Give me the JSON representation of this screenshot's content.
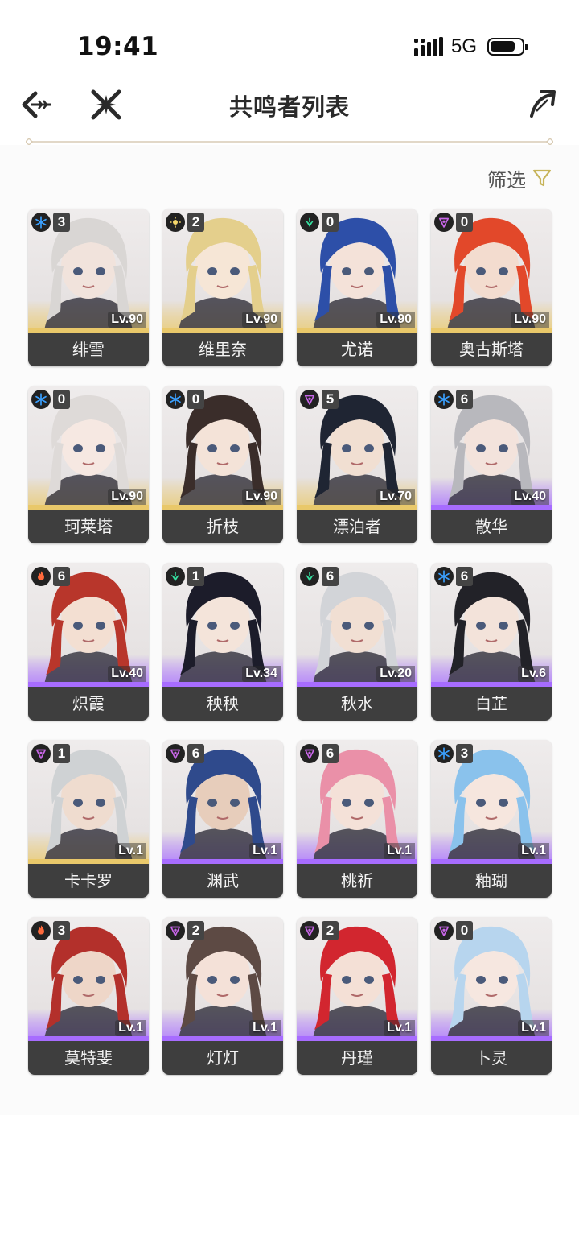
{
  "status_bar": {
    "time": "19:41",
    "network": "5G"
  },
  "header": {
    "title": "共鸣者列表",
    "back_icon": "back-arrow-icon",
    "close_icon": "cross-icon",
    "share_icon": "share-arrow-icon"
  },
  "filter": {
    "label": "筛选",
    "icon": "filter-icon",
    "accent": "#c7b45a"
  },
  "rarity_colors": {
    "5": "#e9c86a",
    "4": "#a76cff"
  },
  "element_colors": {
    "glacio": "#3aa0ff",
    "spectro": "#f5d76b",
    "aero": "#35e0a0",
    "havoc": "#c866e8",
    "fusion": "#ff6a3c"
  },
  "characters": [
    {
      "name": "绯雪",
      "level": "Lv.90",
      "cons": "3",
      "element": "glacio",
      "rarity": "5",
      "hair": "#d9d6d4",
      "skin": "#f1e3dc"
    },
    {
      "name": "维里奈",
      "level": "Lv.90",
      "cons": "2",
      "element": "spectro",
      "rarity": "5",
      "hair": "#e4cf8c",
      "skin": "#f6e6d6"
    },
    {
      "name": "尤诺",
      "level": "Lv.90",
      "cons": "0",
      "element": "aero",
      "rarity": "5",
      "hair": "#2d4fa8",
      "skin": "#f4e2d9"
    },
    {
      "name": "奥古斯塔",
      "level": "Lv.90",
      "cons": "0",
      "element": "havoc",
      "rarity": "5",
      "hair": "#e2482a",
      "skin": "#f3dccf"
    },
    {
      "name": "珂莱塔",
      "level": "Lv.90",
      "cons": "0",
      "element": "glacio",
      "rarity": "5",
      "hair": "#dedad8",
      "skin": "#f6e8e2"
    },
    {
      "name": "折枝",
      "level": "Lv.90",
      "cons": "0",
      "element": "glacio",
      "rarity": "5",
      "hair": "#3a2d2a",
      "skin": "#f4e3d8"
    },
    {
      "name": "漂泊者",
      "level": "Lv.70",
      "cons": "5",
      "element": "havoc",
      "rarity": "5",
      "hair": "#1f2533",
      "skin": "#f1dfd2"
    },
    {
      "name": "散华",
      "level": "Lv.40",
      "cons": "6",
      "element": "glacio",
      "rarity": "4",
      "hair": "#b8b8bd",
      "skin": "#f3e3dc"
    },
    {
      "name": "炽霞",
      "level": "Lv.40",
      "cons": "6",
      "element": "fusion",
      "rarity": "4",
      "hair": "#b8362b",
      "skin": "#f3dfd2"
    },
    {
      "name": "秧秧",
      "level": "Lv.34",
      "cons": "1",
      "element": "aero",
      "rarity": "4",
      "hair": "#1c1c2a",
      "skin": "#f4e4da"
    },
    {
      "name": "秋水",
      "level": "Lv.20",
      "cons": "6",
      "element": "aero",
      "rarity": "4",
      "hair": "#d2d4d8",
      "skin": "#f1dfd3"
    },
    {
      "name": "白芷",
      "level": "Lv.6",
      "cons": "6",
      "element": "glacio",
      "rarity": "4",
      "hair": "#222228",
      "skin": "#f3e3da"
    },
    {
      "name": "卡卡罗",
      "level": "Lv.1",
      "cons": "1",
      "element": "havoc",
      "rarity": "5",
      "hair": "#cfd2d4",
      "skin": "#efdccf"
    },
    {
      "name": "渊武",
      "level": "Lv.1",
      "cons": "6",
      "element": "havoc",
      "rarity": "4",
      "hair": "#2f4a8c",
      "skin": "#e7cdbb"
    },
    {
      "name": "桃祈",
      "level": "Lv.1",
      "cons": "6",
      "element": "havoc",
      "rarity": "4",
      "hair": "#ea90a8",
      "skin": "#f4e1d8"
    },
    {
      "name": "釉瑚",
      "level": "Lv.1",
      "cons": "3",
      "element": "glacio",
      "rarity": "4",
      "hair": "#8ac2ec",
      "skin": "#f6e6de"
    },
    {
      "name": "莫特斐",
      "level": "Lv.1",
      "cons": "3",
      "element": "fusion",
      "rarity": "4",
      "hair": "#b3302b",
      "skin": "#eed6c8"
    },
    {
      "name": "灯灯",
      "level": "Lv.1",
      "cons": "2",
      "element": "havoc",
      "rarity": "4",
      "hair": "#5d4a44",
      "skin": "#f4e1d8"
    },
    {
      "name": "丹瑾",
      "level": "Lv.1",
      "cons": "2",
      "element": "havoc",
      "rarity": "4",
      "hair": "#d2262f",
      "skin": "#f4e0d6"
    },
    {
      "name": "卜灵",
      "level": "Lv.1",
      "cons": "0",
      "element": "havoc",
      "rarity": "4",
      "hair": "#b7d5ee",
      "skin": "#f6e7e0"
    }
  ]
}
